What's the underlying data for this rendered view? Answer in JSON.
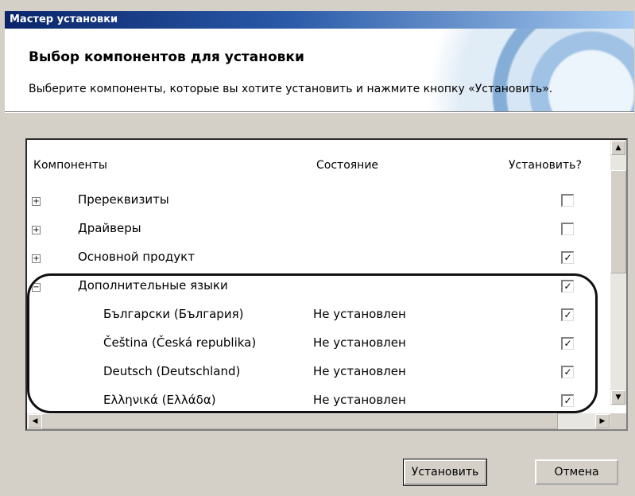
{
  "window": {
    "title": "Мастер установки"
  },
  "header": {
    "title": "Выбор компонентов для установки",
    "subtitle": "Выберите компоненты, которые вы хотите установить и нажмите кнопку «Установить»."
  },
  "list": {
    "columns": {
      "component": "Компоненты",
      "state": "Состояние",
      "install": "Установить?"
    },
    "rows": [
      {
        "expander": "+",
        "label": "Пререквизиты",
        "state": "",
        "checked": false,
        "indent": 0
      },
      {
        "expander": "+",
        "label": "Драйверы",
        "state": "",
        "checked": false,
        "indent": 0
      },
      {
        "expander": "+",
        "label": "Основной продукт",
        "state": "",
        "checked": true,
        "indent": 0
      },
      {
        "expander": "−",
        "label": "Дополнительные языки",
        "state": "",
        "checked": true,
        "indent": 0
      },
      {
        "expander": "",
        "label": "Български (България)",
        "state": "Не установлен",
        "checked": true,
        "indent": 1
      },
      {
        "expander": "",
        "label": "Čeština (Česká republika)",
        "state": "Не установлен",
        "checked": true,
        "indent": 1
      },
      {
        "expander": "",
        "label": "Deutsch (Deutschland)",
        "state": "Не установлен",
        "checked": true,
        "indent": 1
      },
      {
        "expander": "",
        "label": "Ελληνικά (Ελλάδα)",
        "state": "Не установлен",
        "checked": true,
        "indent": 1
      }
    ]
  },
  "buttons": {
    "install": "Установить",
    "cancel": "Отмена"
  }
}
